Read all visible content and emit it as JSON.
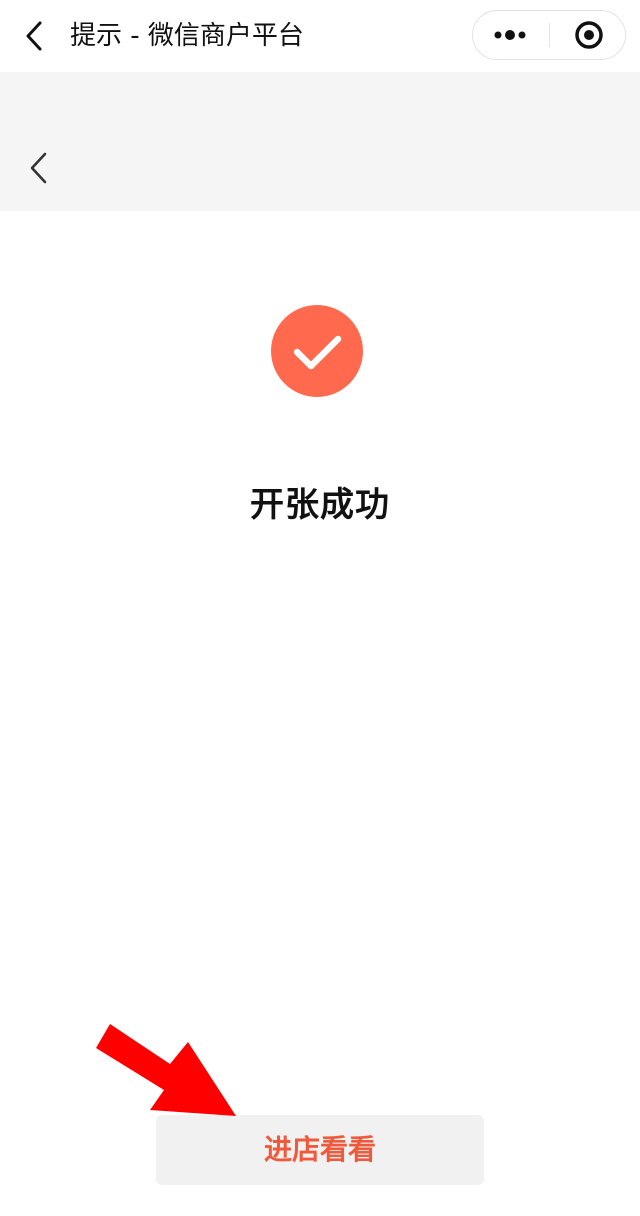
{
  "window": {
    "title": "提示 - 微信商户平台",
    "back_icon": "chevron-left-icon",
    "more_icon": "more-dots-icon",
    "close_icon": "target-close-icon"
  },
  "page_header": {
    "back_icon": "chevron-left-icon"
  },
  "result": {
    "icon": "check-circle-icon",
    "title": "开张成功"
  },
  "actions": {
    "visit_store_label": "进店看看"
  },
  "annotation": {
    "icon": "red-arrow-icon"
  },
  "colors": {
    "accent": "#ff6a4f",
    "button_text": "#f05a3c",
    "header_bg": "#f5f5f5",
    "button_bg": "#f1f1f1",
    "arrow": "#ff0000"
  }
}
